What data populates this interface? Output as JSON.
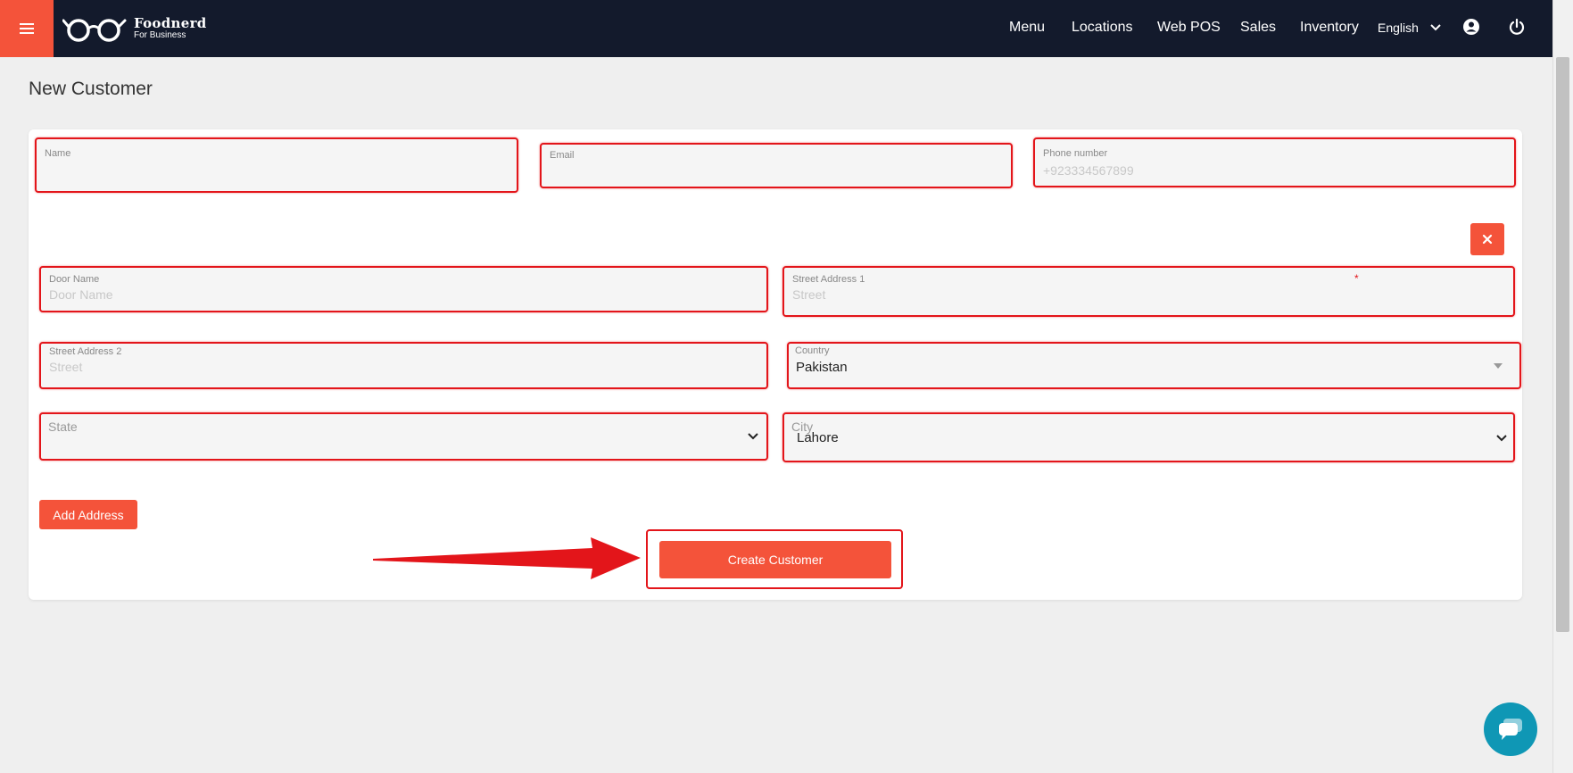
{
  "brand": {
    "name": "Foodnerd",
    "tagline": "For Business"
  },
  "nav": {
    "items": [
      {
        "label": "Menu"
      },
      {
        "label": "Locations"
      },
      {
        "label": "Web POS"
      },
      {
        "label": "Sales"
      },
      {
        "label": "Inventory"
      }
    ],
    "language": "English"
  },
  "page": {
    "title": "New Customer"
  },
  "form": {
    "name": {
      "label": "Name",
      "value": ""
    },
    "email": {
      "label": "Email",
      "value": ""
    },
    "phone": {
      "label": "Phone number",
      "placeholder": "+923334567899"
    },
    "door_name": {
      "label": "Door Name",
      "placeholder": "Door Name"
    },
    "street1": {
      "label": "Street Address 1",
      "placeholder": "Street",
      "required_mark": "*"
    },
    "street2": {
      "label": "Street Address 2",
      "placeholder": "Street"
    },
    "country": {
      "label": "Country",
      "value": "Pakistan"
    },
    "state": {
      "label": "State",
      "value": ""
    },
    "city": {
      "label": "City",
      "value": "Lahore"
    }
  },
  "buttons": {
    "add_address": "Add Address",
    "create_customer": "Create Customer"
  },
  "icons": {
    "menu": "hamburger-menu-icon",
    "logo": "glasses-icon",
    "chevron": "chevron-down-icon",
    "account": "account-circle-icon",
    "power": "power-icon",
    "close": "close-icon",
    "chat": "chat-bubble-icon"
  },
  "colors": {
    "accent": "#f4533a",
    "topbar": "#131a2c",
    "highlight": "#e3151a",
    "chat": "#0f97b5"
  }
}
